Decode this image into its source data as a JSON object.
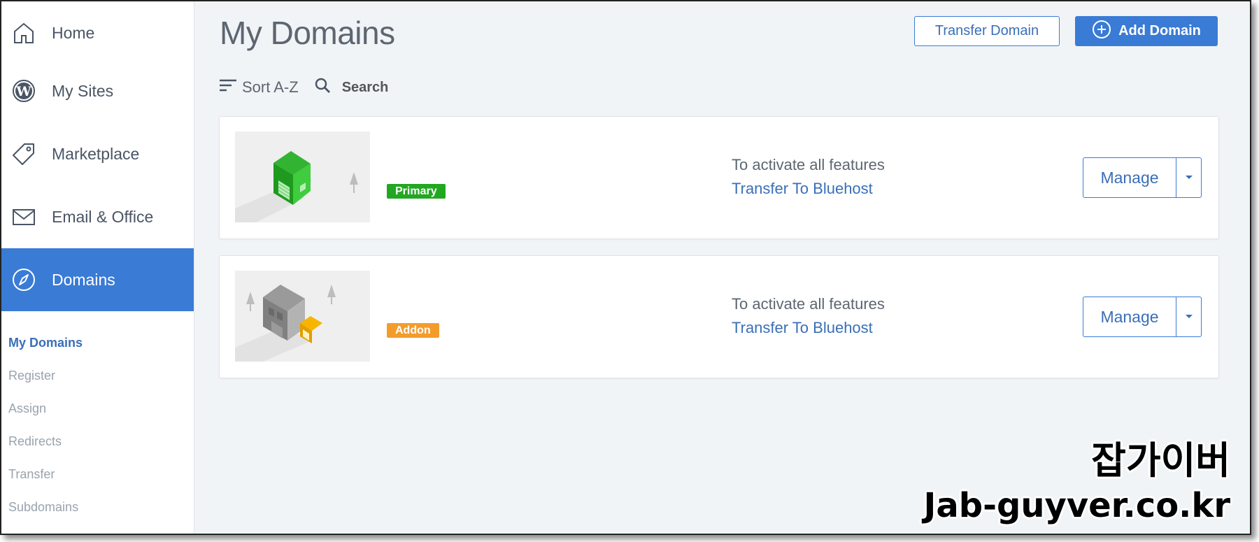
{
  "sidebar": {
    "items": [
      {
        "label": "Home",
        "icon": "home-icon"
      },
      {
        "label": "My Sites",
        "icon": "wordpress-icon"
      },
      {
        "label": "Marketplace",
        "icon": "tag-icon"
      },
      {
        "label": "Email & Office",
        "icon": "envelope-icon"
      },
      {
        "label": "Domains",
        "icon": "compass-icon",
        "active": true
      }
    ],
    "subitems": [
      "My Domains",
      "Register",
      "Assign",
      "Redirects",
      "Transfer",
      "Subdomains"
    ],
    "current_subitem": "My Domains"
  },
  "header": {
    "title": "My Domains",
    "transfer_label": "Transfer Domain",
    "add_label": "Add Domain"
  },
  "toolbar": {
    "sort_label": "Sort A-Z",
    "search_label": "Search"
  },
  "domains": [
    {
      "badge": "Primary",
      "badge_color": "#22a722",
      "message": "To activate all features",
      "link": "Transfer To Bluehost",
      "manage_label": "Manage"
    },
    {
      "badge": "Addon",
      "badge_color": "#f39c2b",
      "message": "To activate all features",
      "link": "Transfer To Bluehost",
      "manage_label": "Manage"
    }
  ],
  "watermark": {
    "line1": "잡가이버",
    "line2": "Jab-guyver.co.kr"
  },
  "colors": {
    "accent": "#3a7bd5",
    "link": "#3a6fb8"
  }
}
